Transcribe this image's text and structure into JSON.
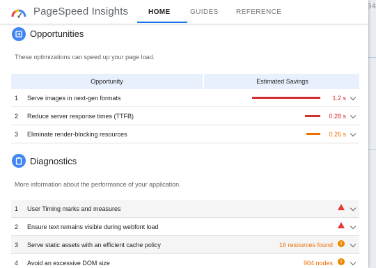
{
  "app": {
    "title": "PageSpeed Insights",
    "tabs": [
      {
        "label": "HOME",
        "active": true
      },
      {
        "label": "GUIDES",
        "active": false
      },
      {
        "label": "REFERENCE",
        "active": false
      }
    ]
  },
  "background": {
    "edge_text": "34"
  },
  "opportunities": {
    "title": "Opportunities",
    "icon": "speed-insights-icon",
    "description": "These optimizations can speed up your page load.",
    "columns": [
      "Opportunity",
      "Estimated Savings"
    ],
    "rows": [
      {
        "index": "1",
        "label": "Serve images in next-gen formats",
        "savings": "1.2 s",
        "savings_fraction": 1.0,
        "color": "#d32f2f"
      },
      {
        "index": "2",
        "label": "Reduce server response times (TTFB)",
        "savings": "0.28 s",
        "savings_fraction": 0.23,
        "color": "#d32f2f"
      },
      {
        "index": "3",
        "label": "Eliminate render-blocking resources",
        "savings": "0.26 s",
        "savings_fraction": 0.22,
        "color": "#ef6c00"
      }
    ]
  },
  "diagnostics": {
    "title": "Diagnostics",
    "icon": "clipboard-icon",
    "description": "More information about the performance of your application.",
    "rows": [
      {
        "index": "1",
        "label": "User Timing marks and measures",
        "detail": "",
        "status": "warning-triangle-icon"
      },
      {
        "index": "2",
        "label": "Ensure text remains visible during webfont load",
        "detail": "",
        "status": "warning-triangle-icon"
      },
      {
        "index": "3",
        "label": "Serve static assets with an efficient cache policy",
        "detail": "16 resources found",
        "status": "info-circle-icon"
      },
      {
        "index": "4",
        "label": "Avoid an excessive DOM size",
        "detail": "904 nodes",
        "status": "info-circle-icon"
      }
    ]
  },
  "colors": {
    "accent": "#1a73e8",
    "error": "#d32f2f",
    "warning": "#ef6c00",
    "table_header": "#e8f0fe"
  }
}
